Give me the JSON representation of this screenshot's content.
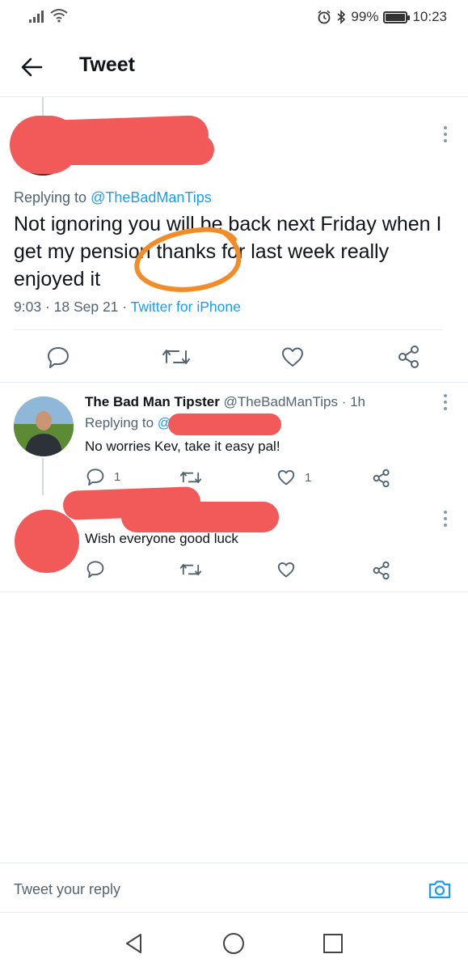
{
  "status_bar": {
    "battery_percent": "99%",
    "battery_level": 0.99,
    "time": "10:23",
    "icons": [
      "signal-icon",
      "wifi-icon",
      "alarm-icon",
      "bluetooth-icon",
      "battery-icon"
    ]
  },
  "header": {
    "title": "Tweet",
    "back_icon": "arrow-left-icon"
  },
  "main_tweet": {
    "replying_prefix": "Replying to",
    "replying_handle": "@TheBadManTips",
    "text": "Not ignoring you will be back next Friday when I get my pension thanks for last week really enjoyed it",
    "time": "9:03 · 18 Sep 21 · ",
    "source": "Twitter for iPhone",
    "annotation_color": "#f28c28",
    "redaction_color": "#f25a5a",
    "actions": [
      "reply-icon",
      "retweet-icon",
      "like-icon",
      "share-icon"
    ]
  },
  "replies": [
    {
      "name": "The Bad Man Tipster",
      "handle": "@TheBadManTips",
      "age": " · 1h",
      "replying_prefix": "Replying to",
      "replying_handle": "@",
      "text": "No worries Kev, take it easy pal!",
      "reply_count": "1",
      "retweet_count": "",
      "like_count": "1"
    },
    {
      "name": "",
      "text": "Wish everyone good luck",
      "reply_count": "",
      "retweet_count": "",
      "like_count": ""
    }
  ],
  "compose": {
    "placeholder": "Tweet your reply",
    "camera_icon": "camera-icon"
  },
  "nav": {
    "icons": [
      "nav-back-icon",
      "nav-home-icon",
      "nav-recents-icon"
    ]
  },
  "colors": {
    "accent": "#1d9bf0",
    "muted": "#536471",
    "divider": "#e6ecf0"
  }
}
